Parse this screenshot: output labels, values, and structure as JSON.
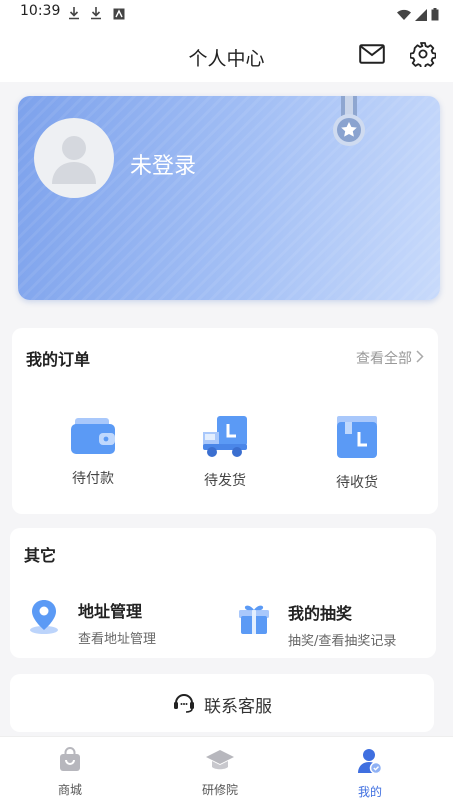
{
  "status_bar": {
    "time": "10:39"
  },
  "header": {
    "title": "个人中心"
  },
  "profile": {
    "login_status": "未登录"
  },
  "orders": {
    "title": "我的订单",
    "view_all": "查看全部",
    "items": [
      {
        "label": "待付款",
        "icon": "wallet-icon"
      },
      {
        "label": "待发货",
        "icon": "truck-icon"
      },
      {
        "label": "待收货",
        "icon": "box-icon"
      }
    ]
  },
  "others": {
    "title": "其它",
    "items": [
      {
        "title": "地址管理",
        "subtitle": "查看地址管理",
        "icon": "location-pin-icon"
      },
      {
        "title": "我的抽奖",
        "subtitle": "抽奖/查看抽奖记录",
        "icon": "gift-icon"
      }
    ]
  },
  "service": {
    "label": "联系客服"
  },
  "bottom_nav": {
    "items": [
      {
        "label": "商城",
        "icon": "shopping-bag-icon"
      },
      {
        "label": "研修院",
        "icon": "graduation-cap-icon"
      },
      {
        "label": "我的",
        "icon": "user-icon",
        "active": true
      }
    ]
  },
  "colors": {
    "accent": "#3f6fe0",
    "card_gradient_start": "#7da2ec",
    "card_gradient_end": "#c8dafb"
  }
}
